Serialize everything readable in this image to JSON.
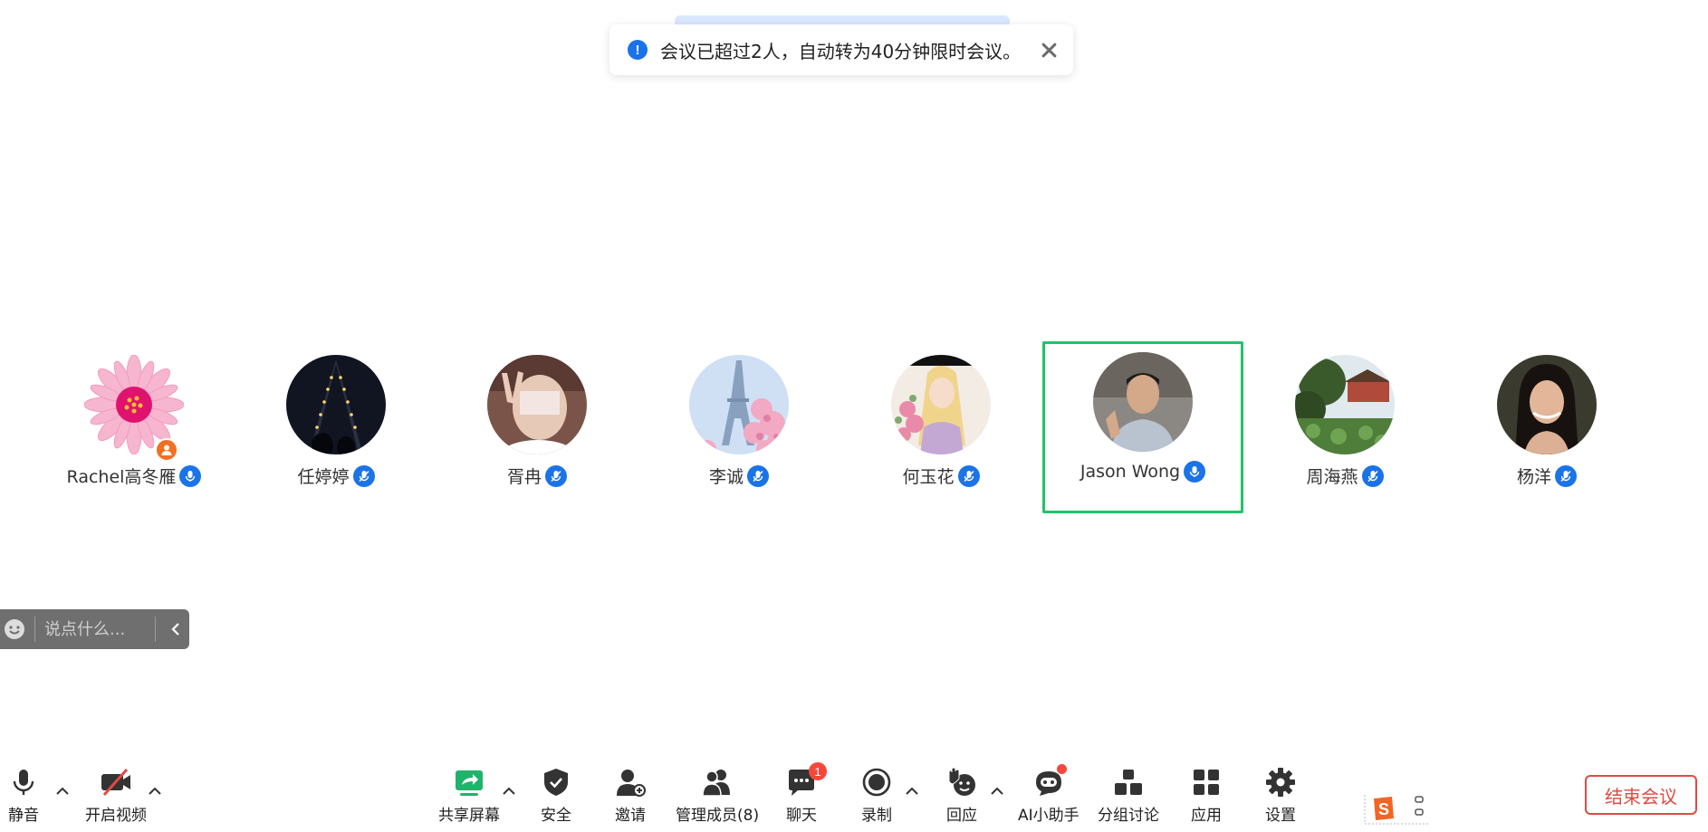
{
  "notification": {
    "text": "会议已超过2人，自动转为40分钟限时会议。",
    "close_label": "✕"
  },
  "participants": [
    {
      "name": "Rachel高冬雁",
      "avatar": "flower-avatar",
      "is_host": true,
      "speaking": false
    },
    {
      "name": "任婷婷",
      "avatar": "night-lights-avatar",
      "is_host": false,
      "speaking": false
    },
    {
      "name": "胥冉",
      "avatar": "person-peace-sign-avatar",
      "is_host": false,
      "speaking": false
    },
    {
      "name": "李诚",
      "avatar": "eiffel-tower-avatar",
      "is_host": false,
      "speaking": false
    },
    {
      "name": "何玉花",
      "avatar": "illustrated-girl-avatar",
      "is_host": false,
      "speaking": false
    },
    {
      "name": "Jason Wong",
      "avatar": "man-portrait-avatar",
      "is_host": false,
      "speaking": true
    },
    {
      "name": "周海燕",
      "avatar": "garden-pavilion-avatar",
      "is_host": false,
      "speaking": false
    },
    {
      "name": "杨洋",
      "avatar": "woman-portrait-avatar",
      "is_host": false,
      "speaking": false
    }
  ],
  "chat": {
    "placeholder": "说点什么..."
  },
  "toolbar": {
    "mute": "静音",
    "video": "开启视频",
    "share_screen": "共享屏幕",
    "security": "安全",
    "invite": "邀请",
    "manage_members": "管理成员(8)",
    "chat": "聊天",
    "chat_badge": "1",
    "record": "录制",
    "reactions": "回应",
    "ai_assistant": "AI小助手",
    "breakout": "分组讨论",
    "apps": "应用",
    "settings": "设置"
  },
  "end_meeting": "结束会议",
  "colors": {
    "accent": "#1a73e8",
    "active_border": "#1fc469",
    "end_button": "#e24a42",
    "badge": "#f5483b"
  }
}
